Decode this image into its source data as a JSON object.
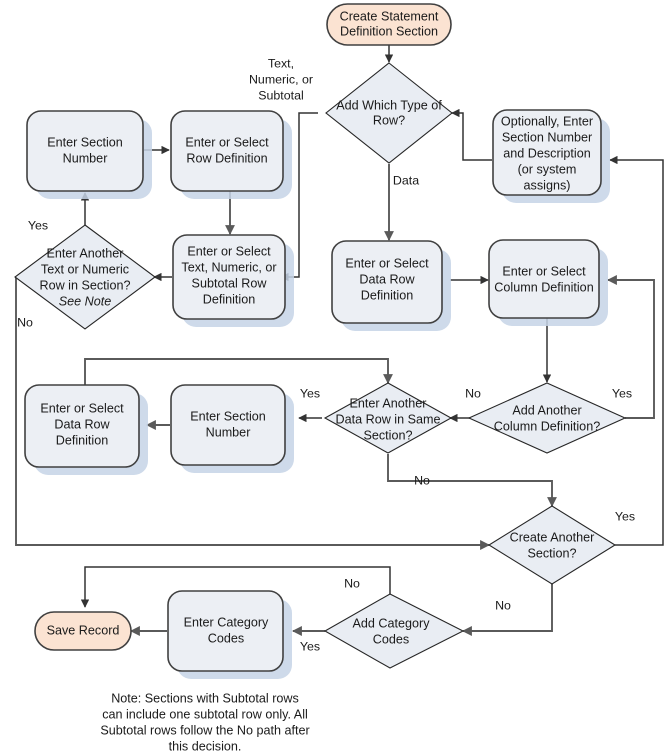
{
  "diagram": {
    "title": "Create Statement Definition Section flowchart",
    "colors": {
      "process_fill": "#eceff4",
      "terminator_fill": "#fbe3d2",
      "decision_fill": "#e9edf3",
      "shadow": "#c6d3e6",
      "border": "#404040",
      "connector": "#5a5a5a"
    },
    "nodes": {
      "start": {
        "type": "terminator",
        "line1": "Create Statement",
        "line2": "Definition Section"
      },
      "add_which_type": {
        "type": "decision",
        "line1": "Add Which Type of",
        "line2": "Row?"
      },
      "optionally_enter": {
        "type": "process",
        "line1": "Optionally, Enter",
        "line2": "Section Number",
        "line3": "and Description",
        "line4": "(or system",
        "line5": "assigns)"
      },
      "enter_section_number_top": {
        "type": "process",
        "line1": "Enter Section",
        "line2": "Number"
      },
      "enter_or_select_row_def": {
        "type": "process",
        "line1": "Enter or Select",
        "line2": "Row Definition"
      },
      "enter_text_numeric_subtotal": {
        "type": "process",
        "line1": "Enter or Select",
        "line2": "Text, Numeric, or",
        "line3": "Subtotal Row",
        "line4": "Definition"
      },
      "enter_another_text_numeric": {
        "type": "decision",
        "line1": "Enter Another",
        "line2": "Text or Numeric",
        "line3": "Row in Section?",
        "line4": "See Note"
      },
      "enter_data_row_def_center": {
        "type": "process",
        "line1": "Enter or Select",
        "line2": "Data Row",
        "line3": "Definition"
      },
      "enter_column_def": {
        "type": "process",
        "line1": "Enter or Select",
        "line2": "Column Definition"
      },
      "add_another_column_def": {
        "type": "decision",
        "line1": "Add Another",
        "line2": "Column Definition?"
      },
      "enter_another_data_row": {
        "type": "decision",
        "line1": "Enter Another",
        "line2": "Data Row in Same",
        "line3": "Section?"
      },
      "enter_section_number_mid": {
        "type": "process",
        "line1": "Enter Section",
        "line2": "Number"
      },
      "enter_data_row_def_left": {
        "type": "process",
        "line1": "Enter or Select",
        "line2": "Data Row",
        "line3": "Definition"
      },
      "create_another_section": {
        "type": "decision",
        "line1": "Create Another",
        "line2": "Section?"
      },
      "add_category_codes": {
        "type": "decision",
        "line1": "Add Category",
        "line2": "Codes"
      },
      "enter_category_codes": {
        "type": "process",
        "line1": "Enter Category",
        "line2": "Codes"
      },
      "save_record": {
        "type": "terminator",
        "line1": "Save Record"
      }
    },
    "edge_labels": {
      "text_numeric_subtotal_1": "Text,",
      "text_numeric_subtotal_2": "Numeric, or",
      "text_numeric_subtotal_3": "Subtotal",
      "data": "Data",
      "yes_text_numeric": "Yes",
      "no_text_numeric": "No",
      "yes_data_row": "Yes",
      "no_data_row": "No",
      "no_column_def": "No",
      "yes_column_def": "Yes",
      "yes_create_section": "Yes",
      "no_create_section": "No",
      "no_category_codes": "No",
      "yes_category_codes": "Yes"
    },
    "note": {
      "line1": "Note: Sections with Subtotal rows",
      "line2": "can include one subtotal row only. All",
      "line3": "Subtotal rows follow the No path after",
      "line4": "this decision."
    }
  }
}
